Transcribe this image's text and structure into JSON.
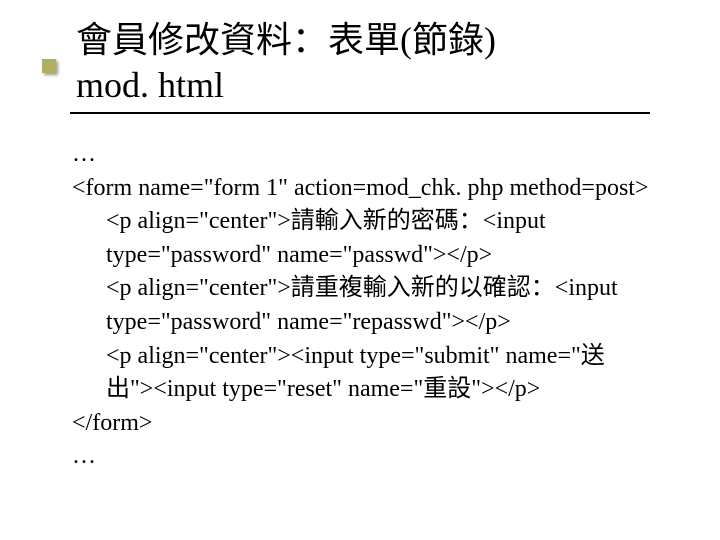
{
  "title": {
    "line1": "會員修改資料：表單(節錄)",
    "line2": "mod. html"
  },
  "code": {
    "l1": "…",
    "l2": "<form name=\"form 1\" action=mod_chk. php method=post>",
    "l3": "<p align=\"center\">請輸入新的密碼：<input type=\"password\" name=\"passwd\"></p>",
    "l4": "<p align=\"center\">請重複輸入新的以確認：<input type=\"password\" name=\"repasswd\"></p>",
    "l5": "<p align=\"center\"><input type=\"submit\" name=\"送出\"><input type=\"reset\" name=\"重設\"></p>",
    "l6": "</form>",
    "l7": "…"
  }
}
